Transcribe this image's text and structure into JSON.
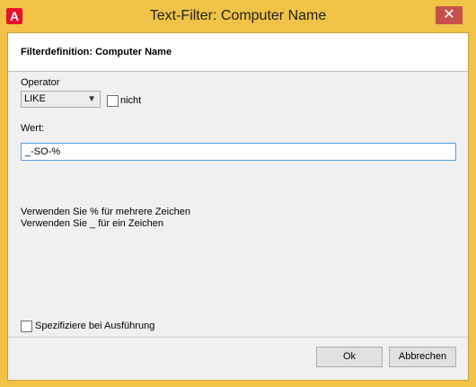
{
  "window": {
    "title": "Text-Filter: Computer Name",
    "app_icon_letter": "A",
    "close_glyph": "✕"
  },
  "header": {
    "text": "Filterdefinition: Computer Name"
  },
  "operator": {
    "label": "Operator",
    "selected": "LIKE",
    "not_label": "nicht",
    "not_checked": false
  },
  "value": {
    "label": "Wert:",
    "current": "_-SO-%"
  },
  "hints": [
    "Verwenden Sie % für mehrere Zeichen",
    "Verwenden Sie _ für ein Zeichen"
  ],
  "specify": {
    "label": "Spezifiziere bei Ausführung",
    "checked": false
  },
  "buttons": {
    "ok": "Ok",
    "cancel": "Abbrechen"
  },
  "colors": {
    "titlebar": "#f0c247",
    "close": "#c7504d",
    "icon": "#e8112d"
  }
}
